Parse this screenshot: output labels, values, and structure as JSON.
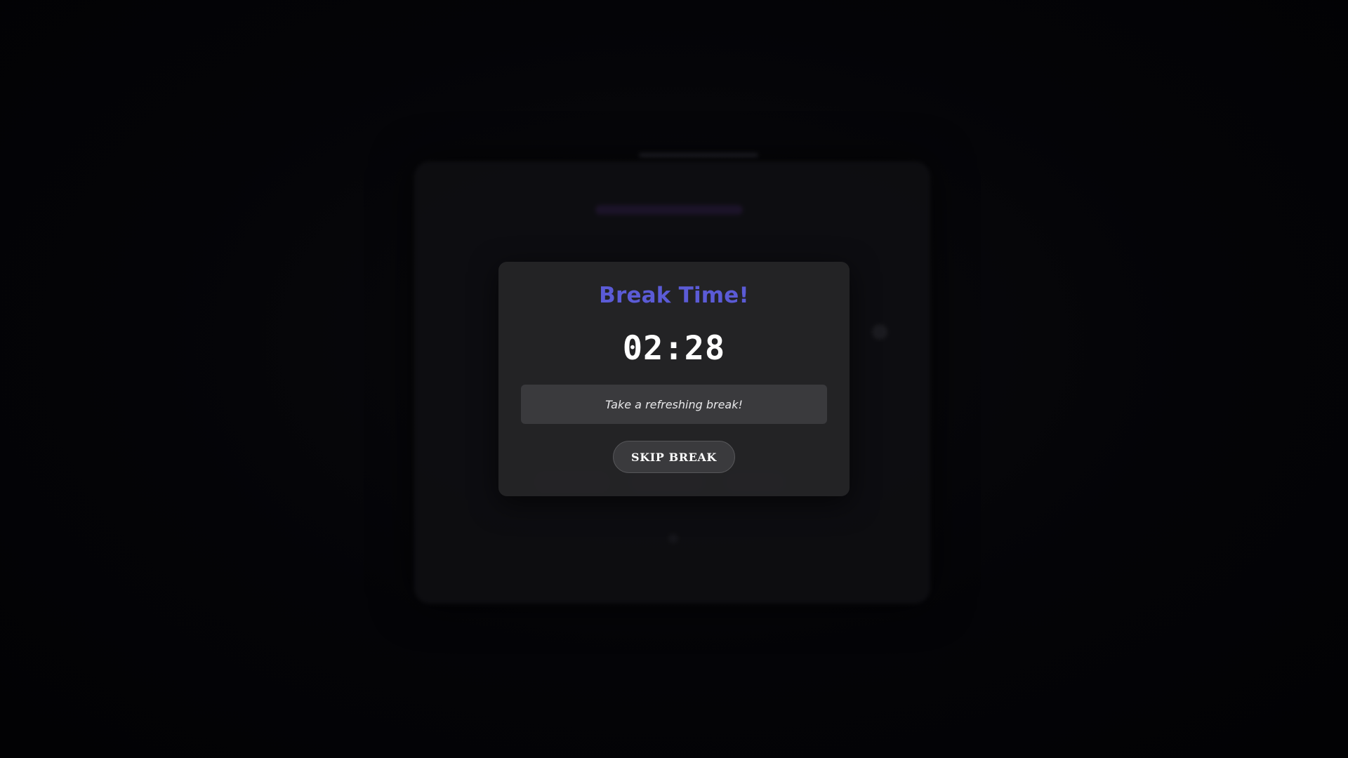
{
  "break_modal": {
    "title": "Break Time!",
    "timer": "02:28",
    "message": "Take a refreshing break!",
    "skip_label": "SKIP BREAK"
  },
  "colors": {
    "accent": "#5b5bd6",
    "modal_background": "#242427",
    "message_background": "#3a3a3d",
    "page_background": "#020205"
  }
}
